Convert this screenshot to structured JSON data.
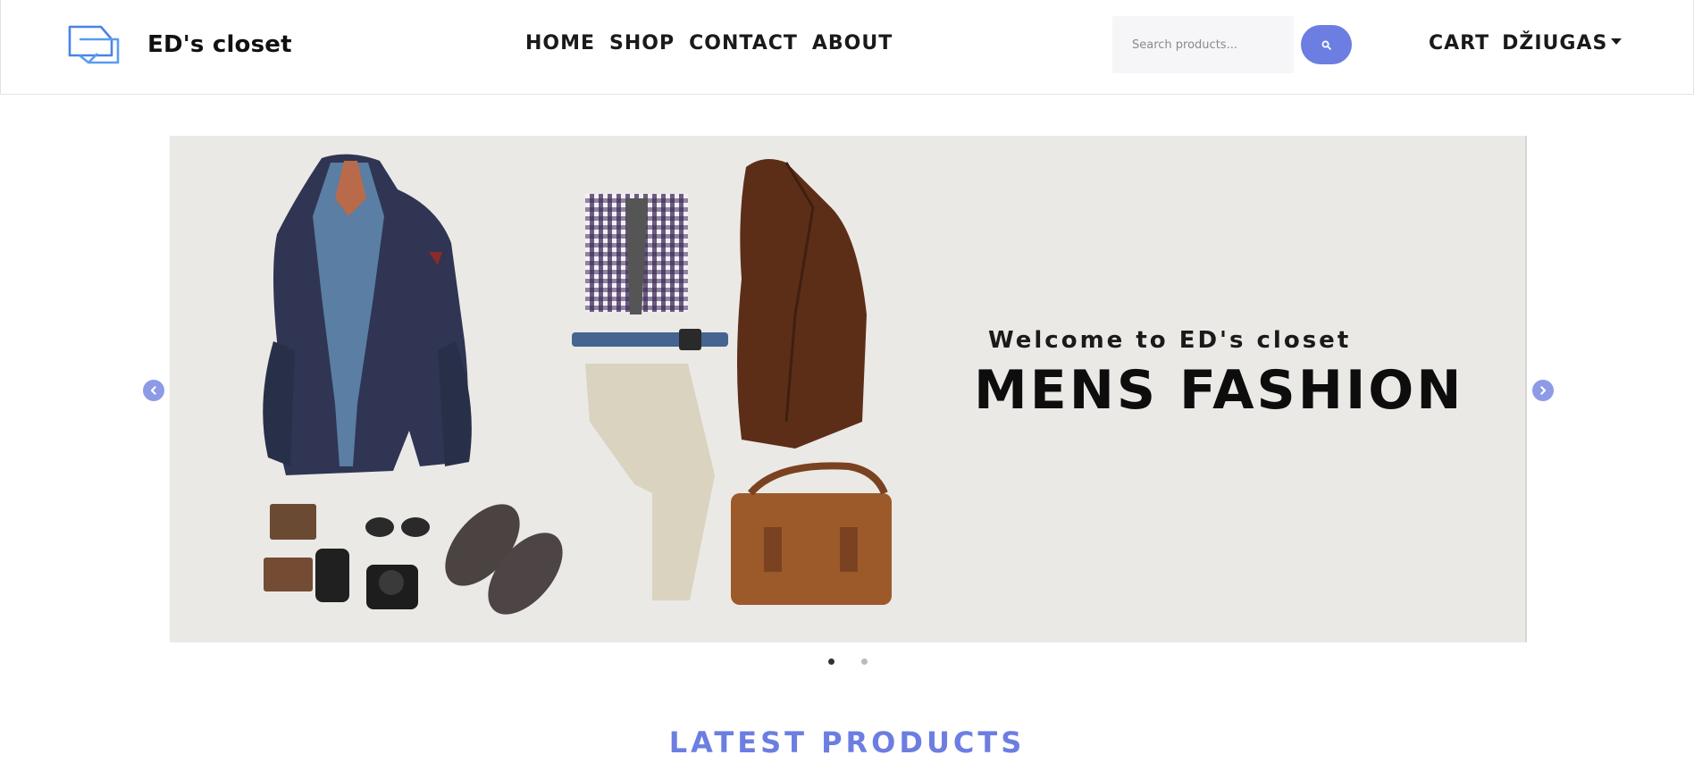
{
  "header": {
    "brand": "ED's closet",
    "logo_icon": "overlapping-squares-logo",
    "nav": [
      "HOME",
      "SHOP",
      "CONTACT",
      "ABOUT"
    ],
    "search": {
      "placeholder": "Search products...",
      "button_icon": "search-icon"
    },
    "cart_label": "CART",
    "user_label": "DŽIUGAS"
  },
  "carousel": {
    "subtitle": "Welcome to ED's closet",
    "title": "MENS FASHION",
    "prev_icon": "chevron-left-icon",
    "next_icon": "chevron-right-icon",
    "slide_count": 2,
    "active_slide": 1
  },
  "section": {
    "title": "LATEST PRODUCTS"
  },
  "colors": {
    "accent": "#6c7ee1",
    "arrow": "#8d9be6",
    "banner_bg": "#ebe9e6"
  }
}
